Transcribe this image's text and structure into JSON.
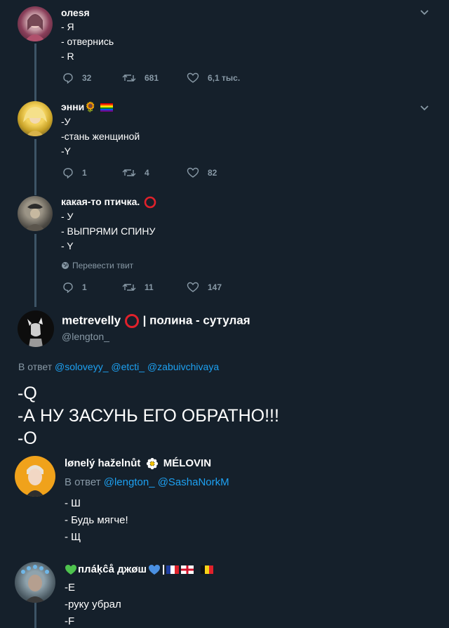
{
  "tweets": [
    {
      "name": "олеsя",
      "lines": [
        "- Я",
        "- отвернись",
        "- R"
      ],
      "actions": {
        "replies": "32",
        "retweets": "681",
        "likes": "6,1 тыс."
      }
    },
    {
      "name": "энни🌻",
      "lines": [
        "-У",
        "-стань женщиной",
        "-Y"
      ],
      "actions": {
        "replies": "1",
        "retweets": "4",
        "likes": "82"
      }
    },
    {
      "name": "какая-то птичка.",
      "lines": [
        "- У",
        "- ВЫПРЯМИ СПИНУ",
        "- Y"
      ],
      "translate": "Перевести твит",
      "actions": {
        "replies": "1",
        "retweets": "11",
        "likes": "147"
      }
    }
  ],
  "main": {
    "name_a": "metrevelly",
    "name_b": "| полина - сутулая",
    "handle": "@lengton_",
    "reply_prefix": "В ответ",
    "reply_to": [
      "@soloveyy_",
      "@etcti_",
      "@zabuivchivaya"
    ],
    "lines": [
      "-Q",
      "-А НУ ЗАСУНЬ ЕГО ОБРАТНО!!!",
      "-O"
    ]
  },
  "reply1": {
    "name_a": "lønelý haželnůt",
    "name_b": "MÉLOVIN",
    "reply_prefix": "В ответ",
    "reply_to": [
      "@lengton_",
      "@SashaNorkM"
    ],
    "lines": [
      "- Ш",
      "- Будь мягче!",
      "- Щ"
    ]
  },
  "reply2": {
    "name": "плáķĉå джøш",
    "lines": [
      "-E",
      "-руку убрал",
      "-F"
    ]
  },
  "colors": {
    "background": "#15202b",
    "muted": "#8899a6",
    "link": "#1da1f2",
    "thread": "#3d5466"
  }
}
